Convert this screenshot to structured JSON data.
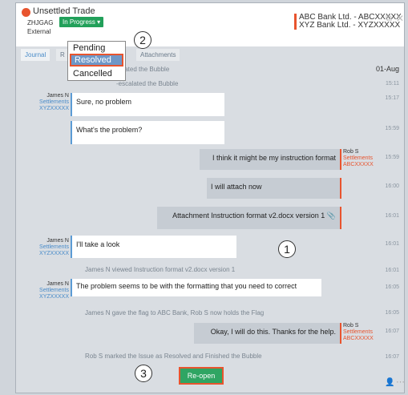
{
  "header": {
    "title": "Unsettled Trade",
    "code": "ZHJGAG",
    "status": "In Progress",
    "type": "External",
    "bank1": "ABC Bank Ltd. - ABCXXXXX",
    "bank2": "XYZ Bank Ltd. - XYZXXXXX"
  },
  "tabs": {
    "journal": "Journal",
    "other": "R",
    "attachments": "Attachments"
  },
  "status_menu": {
    "pending": "Pending",
    "resolved": "Resolved",
    "cancelled": "Cancelled"
  },
  "callouts": {
    "one": "1",
    "two": "2",
    "three": "3"
  },
  "chat": {
    "date": "01-Aug",
    "sys1": "calated the Bubble",
    "sys2": "-escalated the Bubble",
    "t1": "15:11",
    "sender_james": {
      "name": "James N",
      "role": "Settlements",
      "bank": "XYZXXXXX"
    },
    "sender_rob": {
      "name": "Rob S",
      "role": "Settlements",
      "bank": "ABCXXXXX"
    },
    "m1": "Sure, no problem",
    "m1_time": "15:17",
    "m2": "What's the problem?",
    "m2_time": "15:59",
    "m3": "I think it might be my instruction format",
    "m3_time": "15:59",
    "m4": "I will attach now",
    "m4_time": "16:00",
    "m5": "Attachment Instruction format v2.docx version 1",
    "m5_time": "16:01",
    "m6": "I'll take a look",
    "m6_time": "16:01",
    "sys3": "James N viewed Instruction format v2.docx version 1",
    "sys3_time": "16:01",
    "m7": "The problem seems to be with the formatting that you need to correct",
    "m7_time": "16:05",
    "sys4": "James N gave the flag to ABC Bank, Rob S now holds the Flag",
    "sys4_time": "16:05",
    "m8": "Okay, I will do this. Thanks for the help.",
    "m8_time": "16:07",
    "sys5": "Rob S marked the Issue as Resolved and Finished the Bubble",
    "sys5_time": "16:07"
  },
  "footer": {
    "reopen": "Re-open"
  },
  "colors": {
    "accent": "#e8542e",
    "green": "#2fa563",
    "blue": "#5b9bd5"
  }
}
